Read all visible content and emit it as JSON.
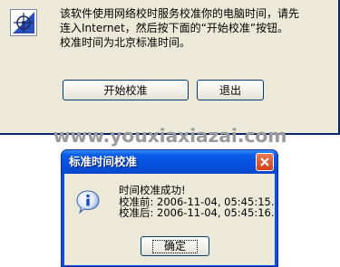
{
  "main_window": {
    "message_lines": [
      "该软件使用网络校时服务校准你的电脑时间，请先",
      "连入Internet，然后按下面的“开始校准”按钮。",
      "校准时间为北京标准时间。"
    ],
    "buttons": {
      "start": "开始校准",
      "exit": "退出"
    },
    "icon": "sync-time-icon"
  },
  "watermark": "www.youxiaxiazai.com",
  "dialog": {
    "title": "标准时间校准",
    "icon": "info-icon",
    "message_lines": [
      "时间校准成功!",
      "校准前: 2006-11-04, 05:45:15.",
      "校准后: 2006-11-04, 05:45:16."
    ],
    "ok_label": "确定",
    "close_icon": "close-icon"
  },
  "colors": {
    "window_bg": "#ece9d8",
    "titlebar": "#0a5ce8",
    "close_button": "#d0421a",
    "watermark": "#9a9a9a"
  }
}
